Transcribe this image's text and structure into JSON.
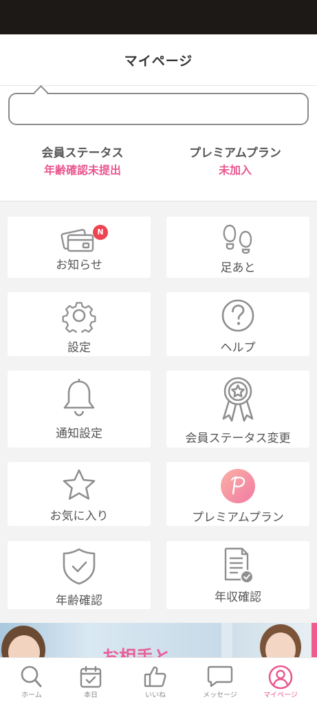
{
  "header": {
    "title": "マイページ"
  },
  "profile": {
    "member_status_label": "会員ステータス",
    "member_status_value": "年齢確認未提出",
    "premium_label": "プレミアムプラン",
    "premium_value": "未加入"
  },
  "menu": {
    "notices": {
      "label": "お知らせ",
      "badge": "N",
      "icon": "cards-icon"
    },
    "footprints": {
      "label": "足あと",
      "icon": "footprints-icon"
    },
    "settings": {
      "label": "設定",
      "icon": "gear-icon"
    },
    "help": {
      "label": "ヘルプ",
      "icon": "question-icon"
    },
    "notification_settings": {
      "label": "通知設定",
      "icon": "bell-icon"
    },
    "member_status_change": {
      "label": "会員ステータス変更",
      "icon": "award-ribbon-icon"
    },
    "favorites": {
      "label": "お気に入り",
      "icon": "star-icon"
    },
    "premium_plan": {
      "label": "プレミアムプラン",
      "icon": "premium-p-icon"
    },
    "age_verification": {
      "label": "年齢確認",
      "icon": "shield-check-icon"
    },
    "income_verification": {
      "label": "年収確認",
      "icon": "document-check-icon"
    }
  },
  "banner": {
    "text": "お相手と"
  },
  "tabbar": {
    "home": "ホーム",
    "today": "本日",
    "likes": "いいね",
    "messages": "メッセージ",
    "mypage": "マイページ"
  },
  "colors": {
    "accent": "#e9588f",
    "badge": "#ee4452",
    "icon": "#8f8f8f"
  }
}
